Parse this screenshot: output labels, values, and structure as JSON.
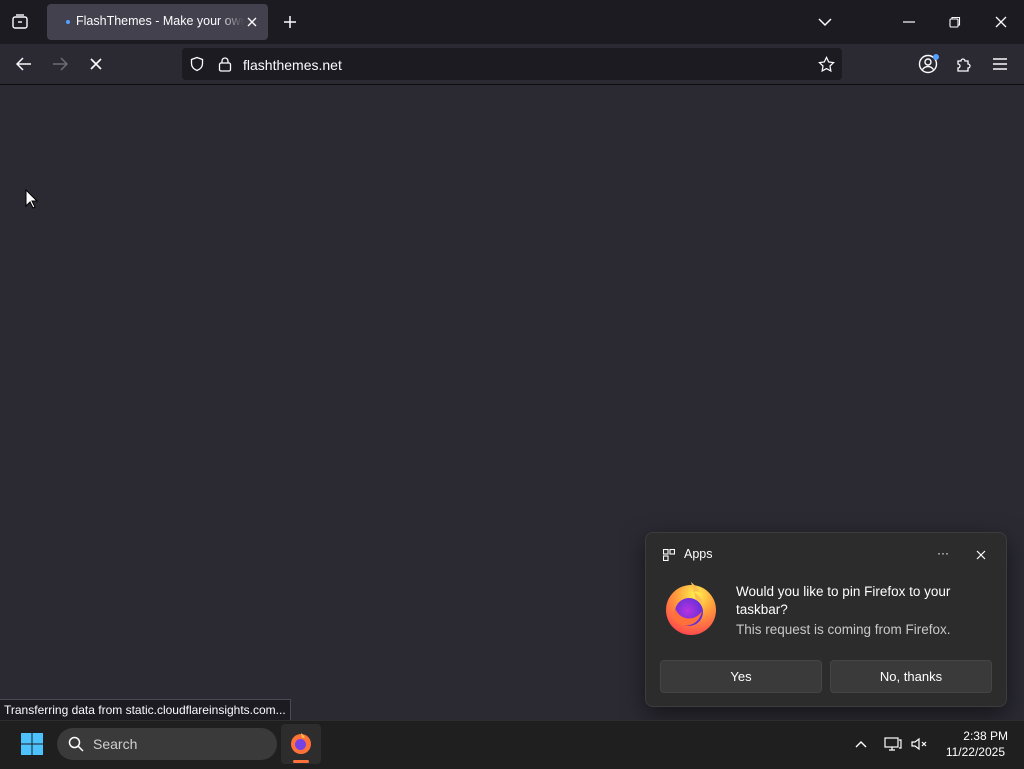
{
  "browser": {
    "tab": {
      "title": "FlashThemes - Make your own animations!"
    },
    "url": "flashthemes.net",
    "status_text": "Transferring data from static.cloudflareinsights.com..."
  },
  "toast": {
    "app_label": "Apps",
    "more_label": "···",
    "message": "Would you like to pin Firefox to your taskbar?",
    "sub_message": "This request is coming from Firefox.",
    "yes_label": "Yes",
    "no_label": "No, thanks"
  },
  "taskbar": {
    "search_placeholder": "Search",
    "time": "2:38 PM",
    "date": "11/22/2025"
  },
  "icons": {
    "tab_list": "tab-list-icon",
    "new_tab": "plus-icon",
    "back": "back-arrow-icon",
    "forward": "forward-arrow-icon",
    "stop": "stop-icon",
    "tracking": "shield-icon",
    "lock": "lock-icon",
    "bookmark": "star-icon",
    "account": "account-icon",
    "extensions": "puzzle-icon",
    "menu": "hamburger-icon"
  },
  "colors": {
    "accent": "#54a0ff",
    "firefox_orange": "#ff7139",
    "firefox_purple": "#7542e5"
  }
}
